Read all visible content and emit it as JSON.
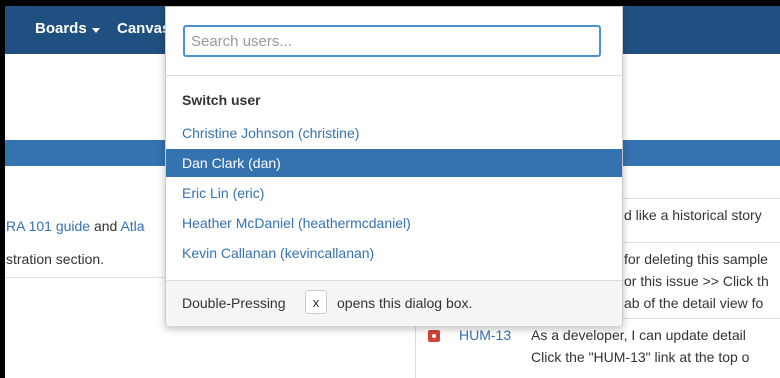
{
  "nav": {
    "boards": "Boards",
    "canvas": "Canvas"
  },
  "background": {
    "guide_link": "RA 101 guide",
    "and_text": "and",
    "atl_link": "Atla",
    "section_text": "stration section.",
    "right_rows": [
      "d like a historical story",
      "for deleting this sample",
      "or this issue >> Click th",
      "ab of the detail view fo"
    ],
    "issue_key": "HUM-13",
    "issue_line1": "As a developer, I can update detail",
    "issue_line2": "Click the \"HUM-13\" link at the top o"
  },
  "dropdown": {
    "search_placeholder": "Search users...",
    "section_title": "Switch user",
    "users": [
      "Christine Johnson (christine)",
      "Dan Clark (dan)",
      "Eric Lin (eric)",
      "Heather McDaniel (heathermcdaniel)",
      "Kevin Callanan (kevincallanan)"
    ],
    "selected_index": 1,
    "footer_before": "Double-Pressing",
    "footer_key": "x",
    "footer_after": "opens this dialog box."
  },
  "colors": {
    "nav_bg": "#205081",
    "accent": "#3572b0",
    "issue_icon": "#d04437"
  }
}
